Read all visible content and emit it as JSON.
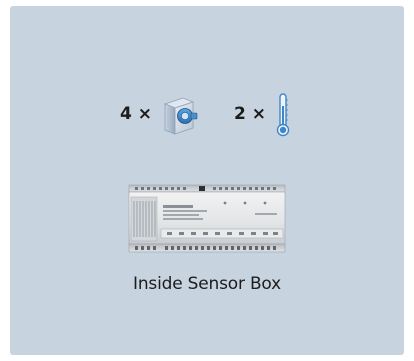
{
  "items": [
    {
      "count_label": "4 ×",
      "icon": "sensor-module-icon"
    },
    {
      "count_label": "2 ×",
      "icon": "thermometer-icon"
    }
  ],
  "device": {
    "icon": "sensor-box-device",
    "caption": "Inside Sensor Box"
  },
  "colors": {
    "panel_background": "#c8d3e0",
    "text": "#1c1c1c",
    "thermometer": "#3f86c8"
  }
}
